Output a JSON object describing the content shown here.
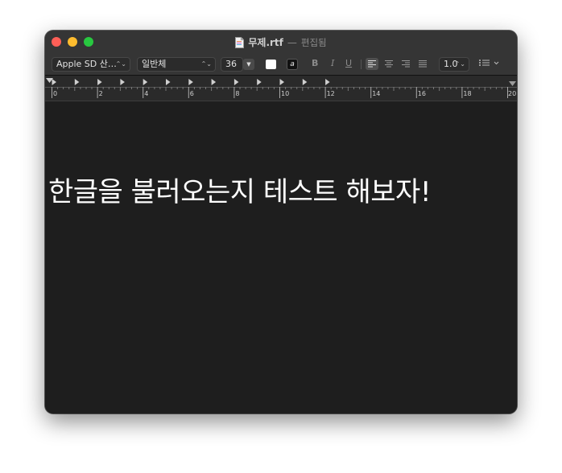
{
  "window": {
    "title": "무제.rtf",
    "separator": "—",
    "state": "편집됨"
  },
  "toolbar": {
    "font_family": "Apple SD 산…",
    "font_style": "일반체",
    "font_size": "36",
    "bold_label": "B",
    "italic_label": "I",
    "underline_label": "U",
    "line_spacing": "1.0",
    "text_color": "#ffffff",
    "highlight_label": "a",
    "alignment": "left"
  },
  "ruler": {
    "labels": [
      "0",
      "2",
      "4",
      "6",
      "8",
      "10",
      "12",
      "14",
      "16",
      "18",
      "20"
    ]
  },
  "document": {
    "text": "한글을 불러오는지 테스트 해보자!"
  },
  "colors": {
    "background": "#1e1e1e",
    "chrome": "#353535",
    "close": "#fe5f57",
    "minimize": "#febc2e",
    "maximize": "#28c840"
  }
}
